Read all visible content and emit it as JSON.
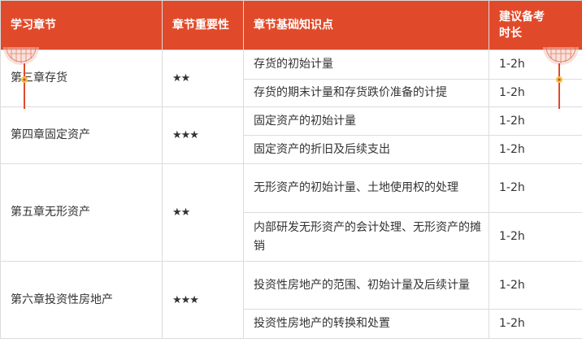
{
  "headers": [
    "学习章节",
    "章节重要性",
    "章节基础知识点",
    "建议备考时长"
  ],
  "groups": [
    {
      "chapter": "第三章存货",
      "stars": "★★",
      "rows": [
        {
          "point": "存货的初始计量",
          "time": "1-2h"
        },
        {
          "point": "存货的期末计量和存货跌价准备的计提",
          "time": "1-2h"
        }
      ]
    },
    {
      "chapter": "第四章固定资产",
      "stars": "★★★",
      "rows": [
        {
          "point": "固定资产的初始计量",
          "time": "1-2h"
        },
        {
          "point": "固定资产的折旧及后续支出",
          "time": "1-2h"
        }
      ]
    },
    {
      "chapter": "第五章无形资产",
      "stars": "★★",
      "rows": [
        {
          "point": "无形资产的初始计量、土地使用权的处理",
          "time": "1-2h"
        },
        {
          "point": "内部研发无形资产的会计处理、无形资产的摊销",
          "time": "1-2h"
        }
      ]
    },
    {
      "chapter": "第六章投资性房地产",
      "stars": "★★★",
      "rows": [
        {
          "point": "投资性房地产的范围、初始计量及后续计量",
          "time": "1-2h"
        },
        {
          "point": "投资性房地产的转换和处置",
          "time": "1-2h"
        }
      ]
    }
  ],
  "colors": {
    "header_bg": "#e04a2a",
    "deco": "#e04a2a"
  },
  "icons": {
    "decoration": "lantern-decoration-icon"
  }
}
